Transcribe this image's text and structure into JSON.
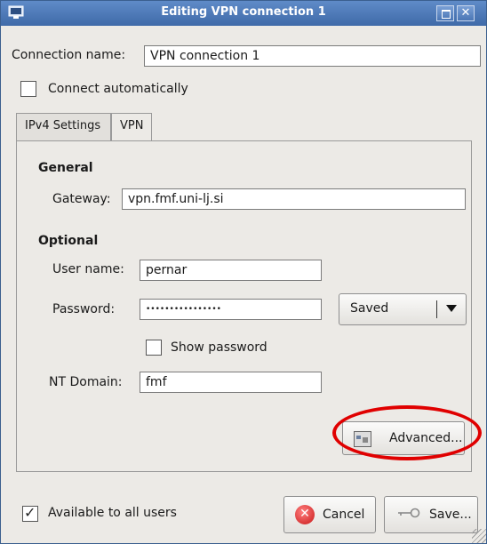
{
  "window": {
    "title": "Editing VPN connection 1",
    "close_glyph": "✕"
  },
  "connection": {
    "name_label": "Connection name:",
    "name_value": "VPN connection 1",
    "connect_auto_label": "Connect automatically",
    "connect_auto_checked": false
  },
  "tabs": [
    {
      "label": "IPv4 Settings",
      "active": false
    },
    {
      "label": "VPN",
      "active": true
    }
  ],
  "vpn": {
    "general_heading": "General",
    "gateway_label": "Gateway:",
    "gateway_value": "vpn.fmf.uni-lj.si",
    "optional_heading": "Optional",
    "username_label": "User name:",
    "username_value": "pernar",
    "password_label": "Password:",
    "password_value": "••••••••••••••••",
    "password_store": "Saved",
    "show_password_label": "Show password",
    "show_password_checked": false,
    "ntdomain_label": "NT Domain:",
    "ntdomain_value": "fmf",
    "advanced_label": "Advanced..."
  },
  "footer": {
    "available_label": "Available to all users",
    "available_checked": true,
    "cancel_label": "Cancel",
    "save_label": "Save..."
  },
  "colors": {
    "highlight": "#e00000",
    "titlebar": "#4f7bbd"
  },
  "icons": [
    "window-app-icon",
    "maximize-icon",
    "close-icon",
    "dropdown-arrow-icon",
    "advanced-icon",
    "cancel-icon",
    "key-icon",
    "resize-grip-icon"
  ]
}
